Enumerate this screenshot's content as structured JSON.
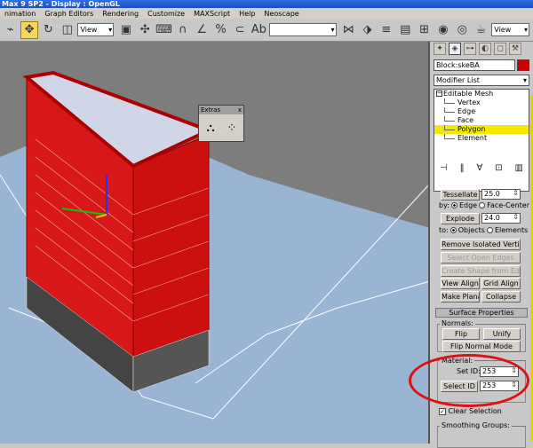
{
  "window": {
    "title": "Max 9 SP2   - Display : OpenGL"
  },
  "menu": [
    "nimation",
    "Graph Editors",
    "Rendering",
    "Customize",
    "MAXScript",
    "Help",
    "Neoscape"
  ],
  "toolbar": {
    "ref_coord": "View",
    "named_sel": "",
    "view_dd": "View"
  },
  "extras": {
    "title": "Extras",
    "close": "x"
  },
  "panel": {
    "object_name": "Block:skeBA",
    "modifier_list": "Modifier List",
    "stack": [
      {
        "label": "Editable Mesh",
        "level": 0
      },
      {
        "label": "Vertex",
        "level": 1
      },
      {
        "label": "Edge",
        "level": 1
      },
      {
        "label": "Face",
        "level": 1
      },
      {
        "label": "Polygon",
        "level": 1,
        "selected": true
      },
      {
        "label": "Element",
        "level": 1
      }
    ],
    "tessellate": {
      "label": "Tessellate",
      "value": "25.0"
    },
    "tess_by": {
      "by": "by:",
      "edge": "Edge",
      "face_center": "Face-Center"
    },
    "explode": {
      "label": "Explode",
      "value": "24.0"
    },
    "explode_to": {
      "to": "to:",
      "objects": "Objects",
      "elements": "Elements"
    },
    "remove_isolated": "Remove Isolated Vertices",
    "select_open_edges": "Select Open Edges",
    "create_shape": "Create Shape from Edges",
    "view_align": "View Align",
    "grid_align": "Grid Align",
    "make_planar": "Make Planar",
    "collapse": "Collapse",
    "surface_props": "Surface Properties",
    "normals": {
      "group": "Normals:",
      "flip": "Flip",
      "unify": "Unify",
      "flip_mode": "Flip Normal Mode"
    },
    "material": {
      "group": "Material:",
      "set_id_label": "Set ID:",
      "set_id": "253",
      "select_id": "Select ID",
      "select_value": "253"
    },
    "clear_selection": "Clear Selection",
    "smoothing_groups": "Smoothing Groups:"
  }
}
